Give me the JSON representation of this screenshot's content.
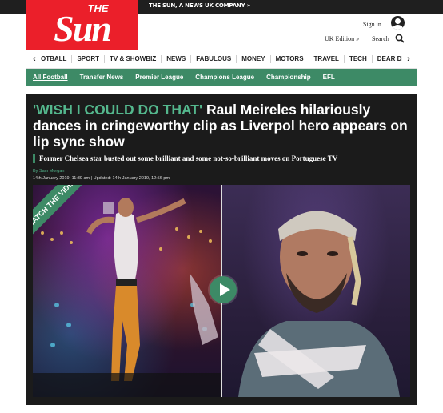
{
  "header": {
    "corporate_text": "THE SUN, A NEWS UK COMPANY »",
    "logo_text_small": "THE",
    "logo_text_large": "Sun",
    "sign_in_label": "Sign in",
    "edition_label": "UK Edition »",
    "search_label": "Search",
    "brand_color": "#eb1f2a"
  },
  "nav": {
    "prev_arrow": "‹",
    "next_arrow": "›",
    "items": [
      "OTBALL",
      "SPORT",
      "TV & SHOWBIZ",
      "NEWS",
      "FABULOUS",
      "MONEY",
      "MOTORS",
      "TRAVEL",
      "TECH",
      "DEAR DEIDRE"
    ]
  },
  "subnav": {
    "items": [
      "All Football",
      "Transfer News",
      "Premier League",
      "Champions League",
      "Championship",
      "EFL"
    ],
    "accent_color": "#3d8a66"
  },
  "article": {
    "kicker": "'WISH I COULD DO THAT'",
    "headline": " Raul Meireles hilariously dances in cringeworthy clip as Liverpol hero appears on lip sync show",
    "standfirst": "Former Chelsea star busted out some brilliant and some not-so-brilliant moves on Portuguese TV",
    "byline": "By Sam Morgan",
    "dates": "14th January 2019, 11:39 am | Updated: 14th January 2019, 12:56 pm",
    "video": {
      "badge_text": "WATCH THE VIDEO",
      "play_icon": "play-icon"
    }
  }
}
